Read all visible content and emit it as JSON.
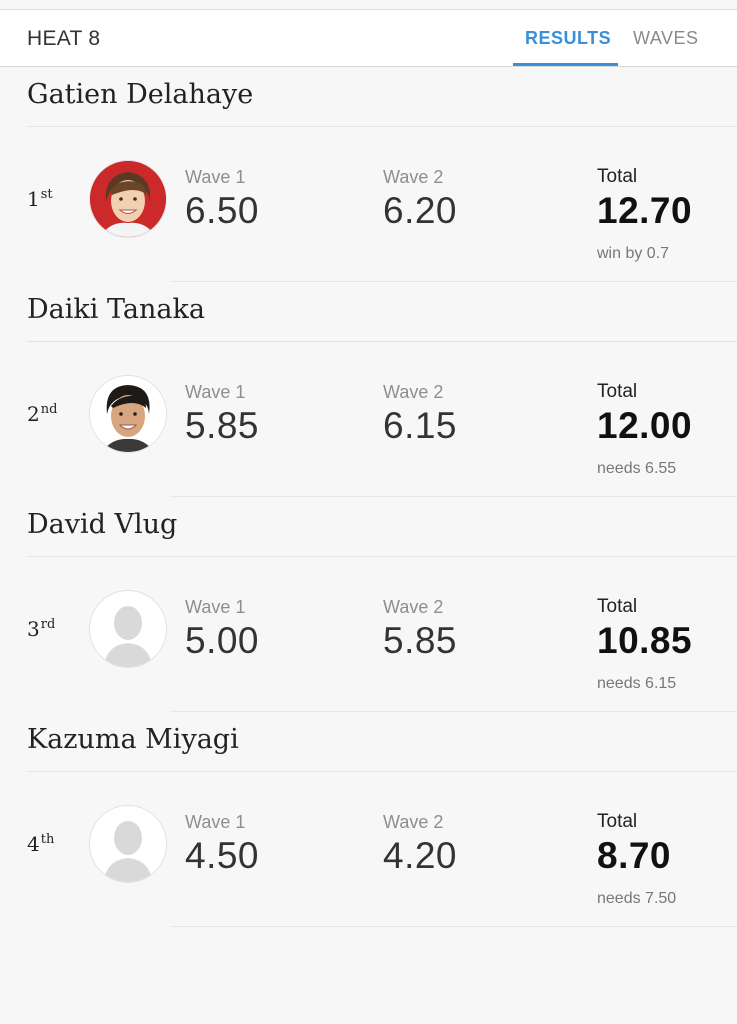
{
  "header": {
    "title": "HEAT 8",
    "tabs": [
      {
        "label": "RESULTS",
        "active": true
      },
      {
        "label": "WAVES",
        "active": false
      }
    ]
  },
  "colors": {
    "accent": "#3a8fd9",
    "avatar_red": "#cc2a2a"
  },
  "athletes": [
    {
      "name": "Gatien Delahaye",
      "rank_num": "1",
      "rank_suffix": "st",
      "wave1_label": "Wave 1",
      "wave1": "6.50",
      "wave2_label": "Wave 2",
      "wave2": "6.20",
      "total_label": "Total",
      "total": "12.70",
      "note": "win by 0.7",
      "avatar": "photo-red-bg"
    },
    {
      "name": "Daiki Tanaka",
      "rank_num": "2",
      "rank_suffix": "nd",
      "wave1_label": "Wave 1",
      "wave1": "5.85",
      "wave2_label": "Wave 2",
      "wave2": "6.15",
      "total_label": "Total",
      "total": "12.00",
      "note": "needs 6.55",
      "avatar": "photo-white-bg"
    },
    {
      "name": "David Vlug",
      "rank_num": "3",
      "rank_suffix": "rd",
      "wave1_label": "Wave 1",
      "wave1": "5.00",
      "wave2_label": "Wave 2",
      "wave2": "5.85",
      "total_label": "Total",
      "total": "10.85",
      "note": "needs 6.15",
      "avatar": "placeholder"
    },
    {
      "name": "Kazuma Miyagi",
      "rank_num": "4",
      "rank_suffix": "th",
      "wave1_label": "Wave 1",
      "wave1": "4.50",
      "wave2_label": "Wave 2",
      "wave2": "4.20",
      "total_label": "Total",
      "total": "8.70",
      "note": "needs 7.50",
      "avatar": "placeholder"
    }
  ]
}
